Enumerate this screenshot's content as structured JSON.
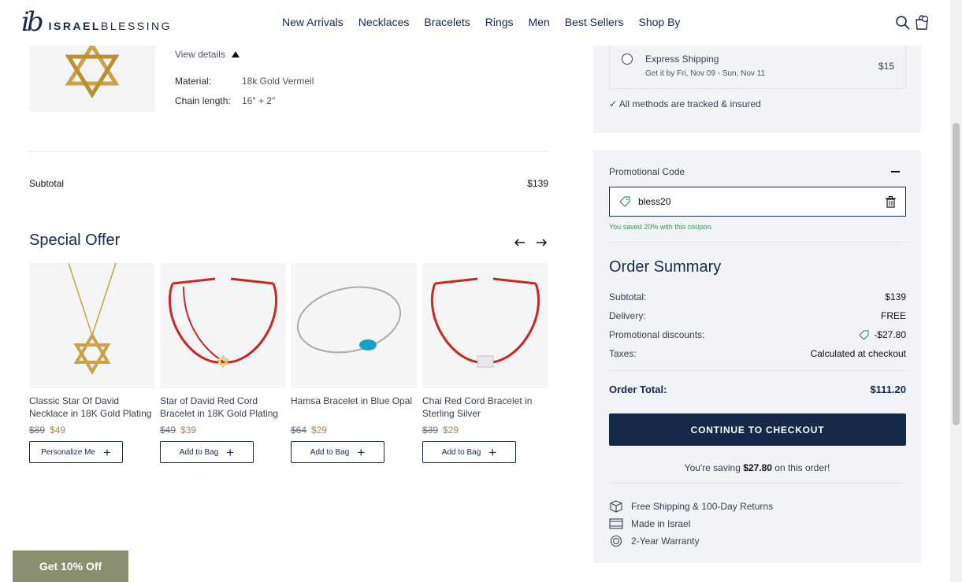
{
  "brand": {
    "mark": "ib",
    "name_bold": "ISRAEL",
    "name_light": "BLESSING"
  },
  "nav": [
    "New Arrivals",
    "Necklaces",
    "Bracelets",
    "Rings",
    "Men",
    "Best Sellers",
    "Shop By"
  ],
  "header_icons": [
    "search-icon",
    "bag-icon"
  ],
  "cart_item": {
    "view_details": "View details",
    "specs": [
      {
        "label": "Material:",
        "value": "18k Gold Vermeil"
      },
      {
        "label": "Chain length:",
        "value": "16\" + 2\""
      }
    ],
    "subtotal_label": "Subtotal",
    "subtotal_value": "$139"
  },
  "special_offer": {
    "title": "Special Offer",
    "products": [
      {
        "name": "Classic Star Of David Necklace in 18K Gold Plating",
        "old_price": "$89",
        "price": "$49",
        "button": "Personalize Me"
      },
      {
        "name": "Star of David Red Cord Bracelet in 18K Gold Plating",
        "old_price": "$49",
        "price": "$39",
        "button": "Add to Bag"
      },
      {
        "name": "Hamsa Bracelet in Blue Opal",
        "old_price": "$64",
        "price": "$29",
        "button": "Add to Bag"
      },
      {
        "name": "Chai Red Cord Bracelet in Sterling Silver",
        "old_price": "$39",
        "price": "$29",
        "button": "Add to Bag"
      }
    ]
  },
  "promo_badge": "Get 10% Off",
  "shipping": {
    "option_name": "Express Shipping",
    "option_sub": "Get it by Fri, Nov 09 - Sun, Nov 11",
    "option_price": "$15",
    "tracked_note": "✓ All methods are tracked & insured"
  },
  "promo": {
    "label": "Promotional Code",
    "code": "bless20",
    "saved_msg": "You saved 20% with this coupon."
  },
  "summary": {
    "title": "Order Summary",
    "rows": [
      {
        "label": "Subtotal:",
        "value": "$139"
      },
      {
        "label": "Delivery:",
        "value": "FREE"
      },
      {
        "label": "Promotional discounts:",
        "value": "-$27.80"
      },
      {
        "label": "Taxes:",
        "value": "Calculated at checkout"
      }
    ],
    "total_label": "Order Total:",
    "total_value": "$111.20",
    "checkout_label": "CONTINUE TO CHECKOUT",
    "saving_prefix": "You're saving ",
    "saving_amount": "$27.80",
    "saving_suffix": " on this order!"
  },
  "features": [
    "Free Shipping & 100-Day Returns",
    "Made in Israel",
    "2-Year Warranty"
  ],
  "colors": {
    "navy": "#15294a",
    "panel": "#f1f3f6",
    "sale": "#a08a5a",
    "success": "#3f8f5a",
    "badge": "#8a8f70"
  }
}
